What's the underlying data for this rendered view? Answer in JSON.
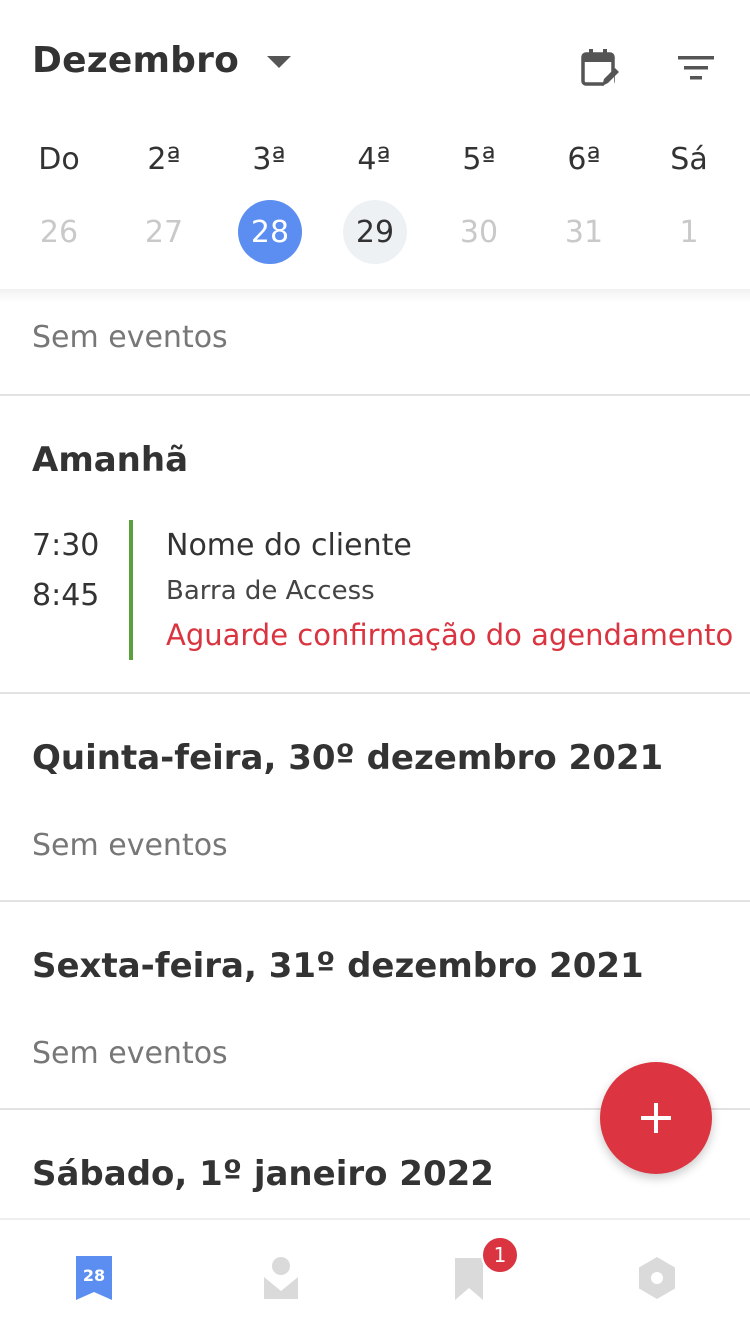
{
  "header": {
    "month": "Dezembro"
  },
  "week": {
    "days": [
      {
        "weekday": "Do",
        "date": "26",
        "state": "past"
      },
      {
        "weekday": "2ª",
        "date": "27",
        "state": "past"
      },
      {
        "weekday": "3ª",
        "date": "28",
        "state": "selected"
      },
      {
        "weekday": "4ª",
        "date": "29",
        "state": "today"
      },
      {
        "weekday": "5ª",
        "date": "30",
        "state": "future"
      },
      {
        "weekday": "6ª",
        "date": "31",
        "state": "future"
      },
      {
        "weekday": "Sá",
        "date": "1",
        "state": "future"
      }
    ]
  },
  "agenda": {
    "first": {
      "empty": "Sem eventos"
    },
    "tomorrow": {
      "title": "Amanhã",
      "event": {
        "start": "7:30",
        "end": "8:45",
        "name": "Nome do cliente",
        "service": "Barra de Access",
        "status": "Aguarde confirmação do agendamento"
      }
    },
    "thursday": {
      "title": "Quinta-feira, 30º dezembro 2021",
      "empty": "Sem eventos"
    },
    "friday": {
      "title": "Sexta-feira, 31º dezembro 2021",
      "empty": "Sem eventos"
    },
    "saturday": {
      "title": "Sábado, 1º janeiro 2022"
    }
  },
  "fab": {
    "label": "+"
  },
  "bottom_nav": {
    "calendar_date": "28",
    "bookmark_badge": "1"
  },
  "colors": {
    "accent_blue": "#5b8ef0",
    "fab_red": "#dc3441",
    "status_red": "#d9343f",
    "event_bar_green": "#5aa03c",
    "nav_inactive": "#dadada"
  },
  "icons": [
    "chevron-down-icon",
    "calendar-edit-icon",
    "filter-icon",
    "plus-icon",
    "calendar-icon",
    "contacts-icon",
    "bookmark-icon",
    "settings-hex-icon"
  ]
}
